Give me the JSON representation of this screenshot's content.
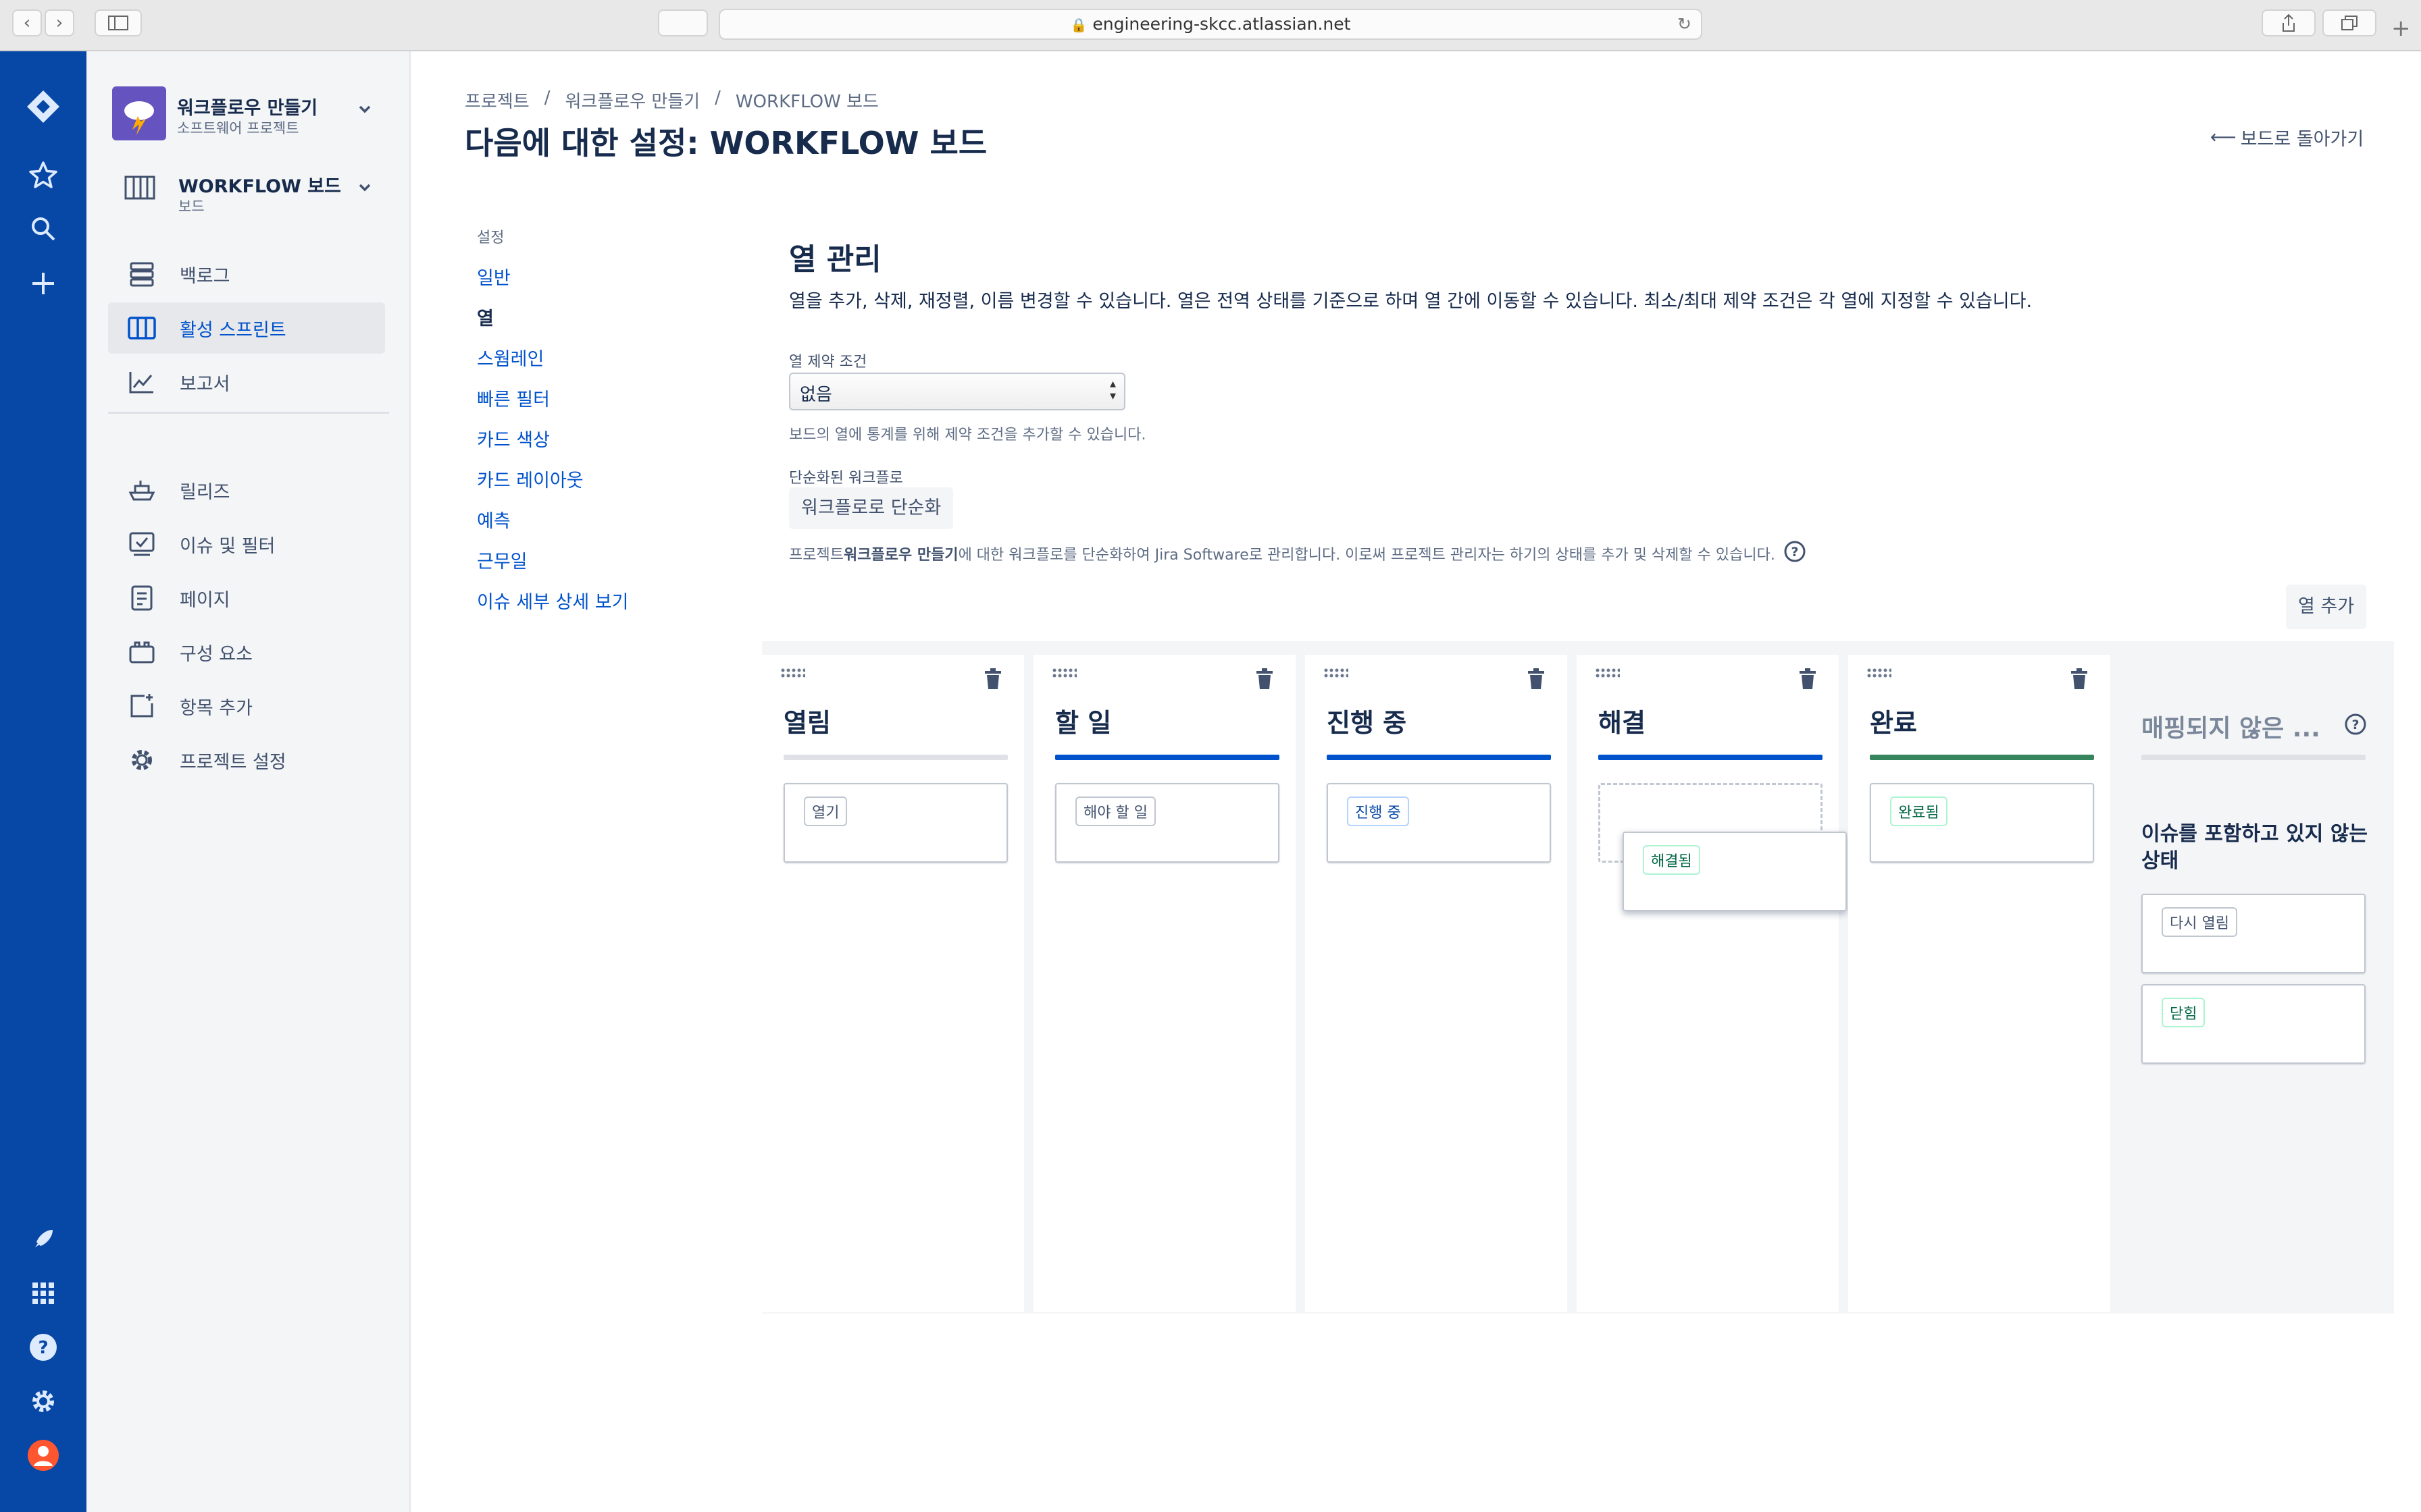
{
  "browser": {
    "url": "engineering-skcc.atlassian.net"
  },
  "project": {
    "name": "워크플로우 만들기",
    "type": "소프트웨어 프로젝트"
  },
  "board_selector": {
    "name": "WORKFLOW 보드",
    "type": "보드"
  },
  "sidebar": {
    "items": [
      {
        "label": "백로그"
      },
      {
        "label": "활성 스프린트"
      },
      {
        "label": "보고서"
      },
      {
        "label": "릴리즈"
      },
      {
        "label": "이슈 및 필터"
      },
      {
        "label": "페이지"
      },
      {
        "label": "구성 요소"
      },
      {
        "label": "항목 추가"
      },
      {
        "label": "프로젝트 설정"
      }
    ]
  },
  "breadcrumb": [
    "프로젝트",
    "/",
    "워크플로우 만들기",
    "/",
    "WORKFLOW 보드"
  ],
  "page_title": "다음에 대한 설정: WORKFLOW 보드",
  "back_to_board": "보드로 돌아가기",
  "settings_nav": {
    "heading": "설정",
    "items": [
      "일반",
      "열",
      "스웜레인",
      "빠른 필터",
      "카드 색상",
      "카드 레이아웃",
      "예측",
      "근무일",
      "이슈 세부 상세 보기"
    ]
  },
  "columns_section": {
    "title": "열 관리",
    "description": "열을 추가, 삭제, 재정렬, 이름 변경할 수 있습니다. 열은 전역 상태를 기준으로 하며 열 간에 이동할 수 있습니다. 최소/최대 제약 조건은 각 열에 지정할 수 있습니다.",
    "constraint_label": "열 제약 조건",
    "constraint_value": "없음",
    "constraint_help": "보드의 열에 통계를 위해 제약 조건을 추가할 수 있습니다.",
    "simplified_label": "단순화된 워크플로",
    "simplify_button": "워크플로로 단순화",
    "simplify_help_pre": "프로젝트 ",
    "simplify_help_bold": "워크플로우 만들기",
    "simplify_help_post": "에 대한 워크플로를 단순화하여 Jira Software로 관리합니다. 이로써 프로젝트 관리자는 하기의 상태를 추가 및 삭제할 수 있습니다.",
    "add_column_button": "열 추가"
  },
  "board_columns": [
    {
      "title": "열림",
      "bar_color": "#dfe1e6",
      "status": "열기",
      "status_style": "grey"
    },
    {
      "title": "할 일",
      "bar_color": "#0052cc",
      "status": "해야 할 일",
      "status_style": "grey"
    },
    {
      "title": "진행 중",
      "bar_color": "#0052cc",
      "status": "진행 중",
      "status_style": "blue"
    },
    {
      "title": "해결",
      "bar_color": "#0052cc",
      "status": "해결됨",
      "status_style": "green"
    },
    {
      "title": "완료",
      "bar_color": "#36845c",
      "status": "완료됨",
      "status_style": "green"
    }
  ],
  "unmapped": {
    "title": "매핑되지 않은 ...",
    "subtitle": "이슈를 포함하고 있지 않는 상태",
    "statuses": [
      {
        "label": "다시 열림",
        "style": "grey"
      },
      {
        "label": "닫힘",
        "style": "green"
      }
    ]
  }
}
